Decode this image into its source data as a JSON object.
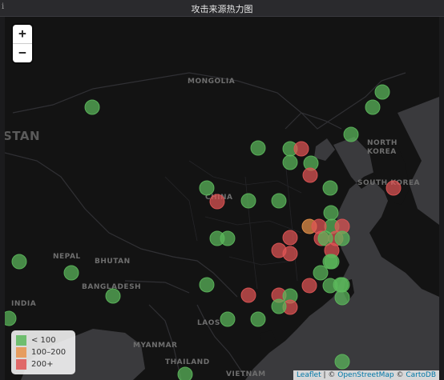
{
  "panel": {
    "title": "攻击来源热力图",
    "info_glyph": "i"
  },
  "zoom": {
    "in_label": "+",
    "out_label": "−"
  },
  "legend": [
    {
      "label": "< 100",
      "color": "#5cb85c"
    },
    {
      "label": "100–200",
      "color": "#e8924a"
    },
    {
      "label": "200+",
      "color": "#e05555"
    }
  ],
  "attribution": {
    "leaflet": "Leaflet",
    "sep": " | © ",
    "osm": "OpenStreetMap",
    "sep2": " © ",
    "carto": "CartoDB"
  },
  "map_labels": [
    {
      "text": "MONGOLIA"
    },
    {
      "text": "STAN"
    },
    {
      "text": "NORTH"
    },
    {
      "text": "KOREA"
    },
    {
      "text": "SOUTH KOREA"
    },
    {
      "text": "CHINA"
    },
    {
      "text": "NEPAL"
    },
    {
      "text": "BHUTAN"
    },
    {
      "text": "BANGLADESH"
    },
    {
      "text": "INDIA"
    },
    {
      "text": "MYANMAR"
    },
    {
      "text": "LAOS"
    },
    {
      "text": "THAILAND"
    },
    {
      "text": "VIETNAM"
    }
  ],
  "markers": [
    {
      "category": "low"
    },
    {
      "category": "low"
    },
    {
      "category": "low"
    },
    {
      "category": "low"
    },
    {
      "category": "low"
    },
    {
      "category": "low"
    },
    {
      "category": "high"
    },
    {
      "category": "low"
    },
    {
      "category": "low"
    },
    {
      "category": "high"
    },
    {
      "category": "low"
    },
    {
      "category": "low"
    },
    {
      "category": "high"
    },
    {
      "category": "low"
    },
    {
      "category": "low"
    },
    {
      "category": "high"
    },
    {
      "category": "low"
    },
    {
      "category": "mid"
    },
    {
      "category": "low"
    },
    {
      "category": "high"
    },
    {
      "category": "high"
    },
    {
      "category": "high"
    },
    {
      "category": "high"
    },
    {
      "category": "low"
    },
    {
      "category": "low"
    },
    {
      "category": "high"
    },
    {
      "category": "high"
    },
    {
      "category": "high"
    },
    {
      "category": "low"
    },
    {
      "category": "low"
    },
    {
      "category": "high"
    },
    {
      "category": "low"
    },
    {
      "category": "low"
    },
    {
      "category": "high"
    },
    {
      "category": "low"
    },
    {
      "category": "low"
    },
    {
      "category": "low"
    },
    {
      "category": "low"
    },
    {
      "category": "low"
    },
    {
      "category": "high"
    },
    {
      "category": "high"
    },
    {
      "category": "low"
    },
    {
      "category": "low"
    },
    {
      "category": "high"
    },
    {
      "category": "low"
    },
    {
      "category": "low"
    },
    {
      "category": "low"
    },
    {
      "category": "low"
    },
    {
      "category": "low"
    },
    {
      "category": "low"
    },
    {
      "category": "low"
    },
    {
      "category": "low"
    },
    {
      "category": "low"
    }
  ],
  "colors": {
    "low": "#5cb85c",
    "mid": "#e8924a",
    "high": "#e05555",
    "ocean": "#3a3a3d",
    "land": "#131313",
    "border": "#2f2f32"
  }
}
